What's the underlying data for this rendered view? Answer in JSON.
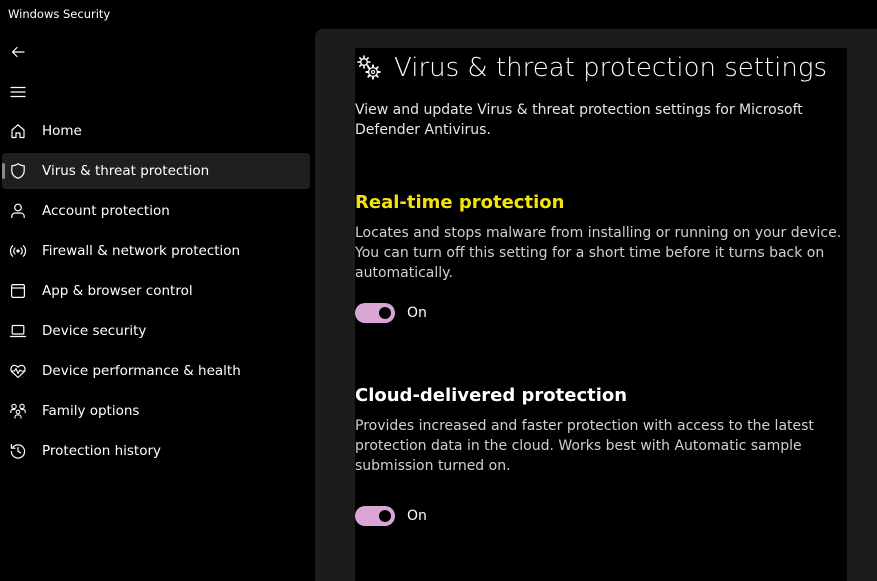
{
  "window": {
    "title": "Windows Security"
  },
  "sidebar": {
    "items": [
      {
        "label": "Home",
        "icon": "home-icon"
      },
      {
        "label": "Virus & threat protection",
        "icon": "shield-icon",
        "active": true
      },
      {
        "label": "Account protection",
        "icon": "person-icon"
      },
      {
        "label": "Firewall & network protection",
        "icon": "wireless-icon"
      },
      {
        "label": "App & browser control",
        "icon": "app-window-icon"
      },
      {
        "label": "Device security",
        "icon": "laptop-icon"
      },
      {
        "label": "Device performance & health",
        "icon": "heart-pulse-icon"
      },
      {
        "label": "Family options",
        "icon": "family-icon"
      },
      {
        "label": "Protection history",
        "icon": "history-icon"
      }
    ]
  },
  "main": {
    "title": "Virus & threat protection settings",
    "description": "View and update Virus & threat protection settings for Microsoft Defender Antivirus.",
    "sections": [
      {
        "title": "Real-time protection",
        "description": "Locates and stops malware from installing or running on your device. You can turn off this setting for a short time before it turns back on automatically.",
        "toggle_state": "On",
        "highlighted": true
      },
      {
        "title": "Cloud-delivered protection",
        "description": "Provides increased and faster protection with access to the latest protection data in the cloud. Works best with Automatic sample submission turned on.",
        "toggle_state": "On"
      }
    ]
  },
  "colors": {
    "background": "#000000",
    "panel": "#1c1c1c",
    "toggle_on": "#d9a6d6",
    "highlight_title": "#f2e40a"
  }
}
